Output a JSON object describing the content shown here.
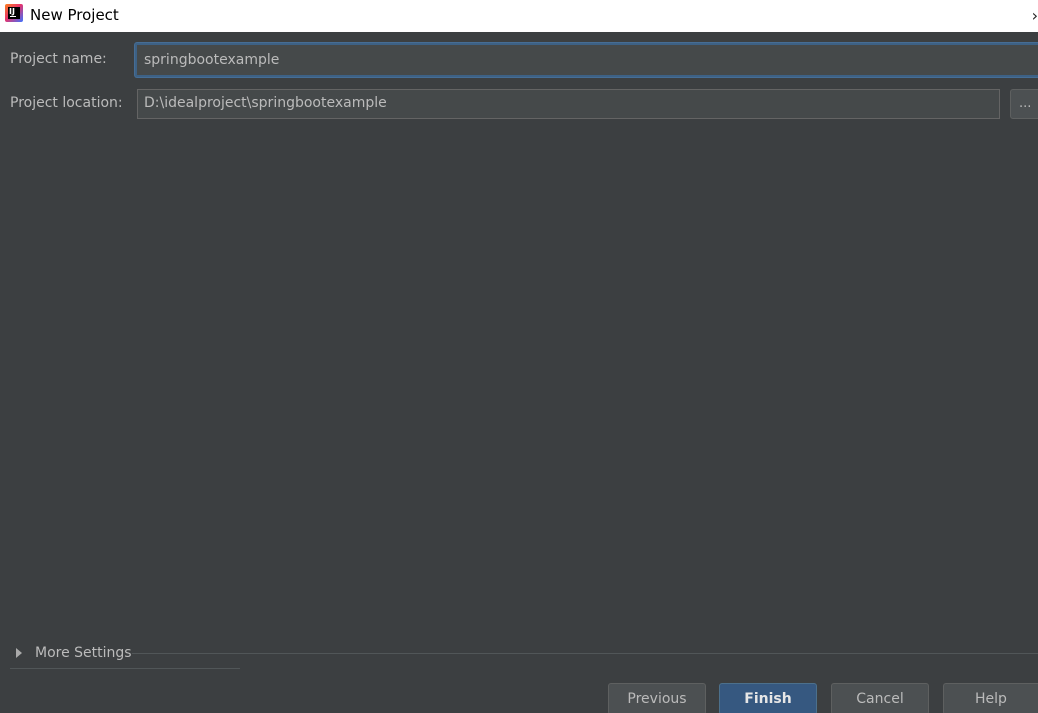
{
  "window": {
    "title": "New Project",
    "title_chevron": "›"
  },
  "form": {
    "project_name_label": "Project name:",
    "project_name_value": "springbootexample",
    "project_location_label": "Project location:",
    "project_location_value": "D:\\idealproject\\springbootexample",
    "browse_label": "..."
  },
  "more_settings": {
    "label": "More Settings",
    "expanded": false
  },
  "buttons": {
    "previous": "Previous",
    "finish": "Finish",
    "cancel": "Cancel",
    "help": "Help"
  },
  "colors": {
    "background": "#3c3f41",
    "field_background": "#45494a",
    "focus_border": "#3d6185",
    "primary_button": "#365880",
    "text": "#bbbbbb"
  },
  "icons": {
    "app": "intellij-idea-icon",
    "expand": "triangle-right-icon"
  }
}
